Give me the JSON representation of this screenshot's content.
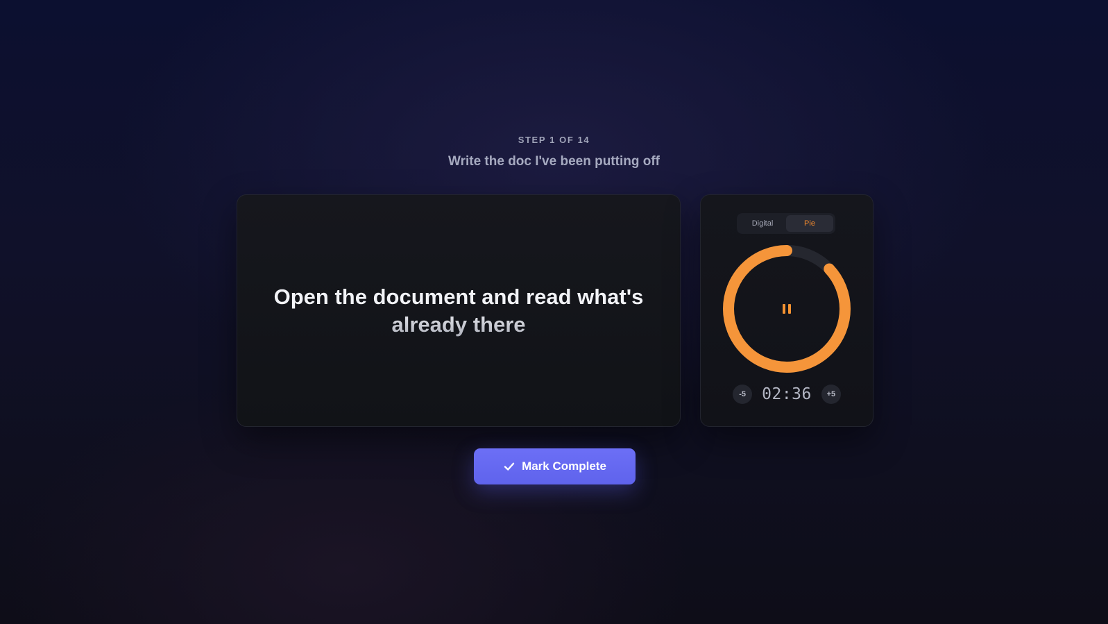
{
  "header": {
    "step_label": "STEP 1 OF 14",
    "goal_title": "Write the doc I've been putting off"
  },
  "task": {
    "text": "Open the document and read what's already there"
  },
  "timer": {
    "modes": [
      {
        "label": "Digital",
        "active": false
      },
      {
        "label": "Pie",
        "active": true
      }
    ],
    "display": "02:36",
    "remaining_fraction": 0.87,
    "minus_label": "-5",
    "plus_label": "+5",
    "state": "running",
    "ring_color": "#f5953a",
    "track_color": "#25272f"
  },
  "actions": {
    "complete_label": "Mark Complete",
    "button_color": "#6366f1"
  },
  "icons": {
    "pause": "pause-icon",
    "check": "check-icon"
  }
}
